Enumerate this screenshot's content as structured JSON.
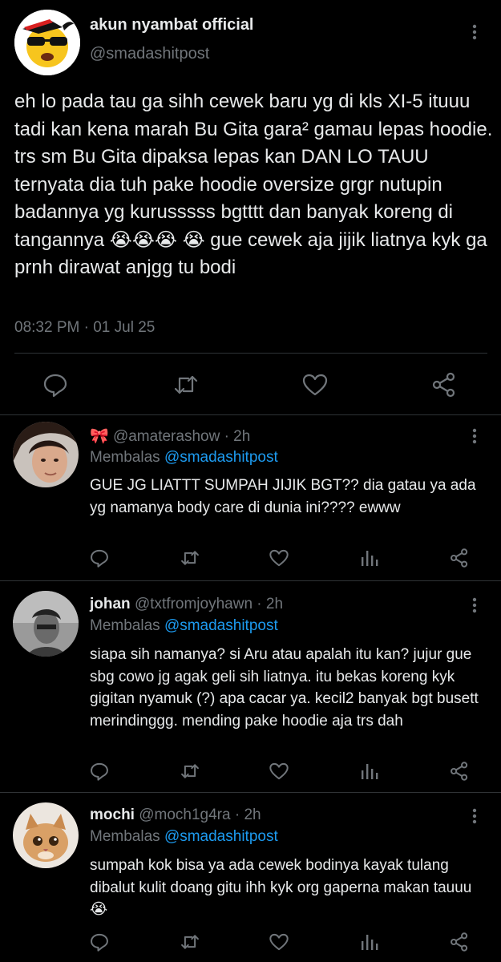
{
  "main_tweet": {
    "name": "akun nyambat official",
    "handle": "@smadashitpost",
    "text": "eh lo pada tau ga sihh cewek baru yg di kls XI-5 ituuu tadi kan kena marah Bu Gita gara² gamau lepas hoodie. trs sm Bu Gita dipaksa lepas kan DAN LO TAUU ternyata dia tuh pake hoodie oversize grgr nutupin badannya yg kurusssss bgtttt dan banyak koreng di tangannya 😭😭😭 😭 gue cewek aja jijik liatnya kyk ga prnh dirawat anjgg tu bodi",
    "timestamp": "08:32 PM · 01 Jul 25",
    "avatar_icon": "emoji-sunglasses-avatar",
    "actions": [
      "reply-icon",
      "retweet-icon",
      "like-icon",
      "share-icon"
    ]
  },
  "replies": [
    {
      "name": "🎀",
      "handle": "@amaterashow",
      "time": "· 2h",
      "replying_label": "Membalas",
      "replying_to": "@smadashitpost",
      "text": "GUE JG LIATTT SUMPAH JIJIK BGT?? dia gatau ya ada yg namanya body care di dunia ini???? ewww",
      "avatar_icon": "user-photo-avatar"
    },
    {
      "name": "johan",
      "handle": "@txtfromjoyhawn",
      "time": "· 2h",
      "replying_label": "Membalas",
      "replying_to": "@smadashitpost",
      "text": "siapa sih namanya? si Aru atau apalah itu kan? jujur gue sbg cowo jg agak geli sih liatnya. itu bekas koreng kyk gigitan nyamuk (?) apa cacar ya. kecil2 banyak bgt busett merindinggg. mending pake hoodie aja trs dah",
      "avatar_icon": "user-photo-avatar"
    },
    {
      "name": "mochi",
      "handle": "@moch1g4ra",
      "time": "· 2h",
      "replying_label": "Membalas",
      "replying_to": "@smadashitpost",
      "text": "sumpah kok bisa ya ada cewek bodinya kayak tulang dibalut kulit doang gitu ihh kyk org gaperna makan tauuu 😭",
      "avatar_icon": "kitten-photo-avatar"
    }
  ],
  "colors": {
    "background": "#000000",
    "text": "#e7e9ea",
    "secondary": "#71767b",
    "accent": "#1d9bf0",
    "divider": "#2f3336"
  }
}
